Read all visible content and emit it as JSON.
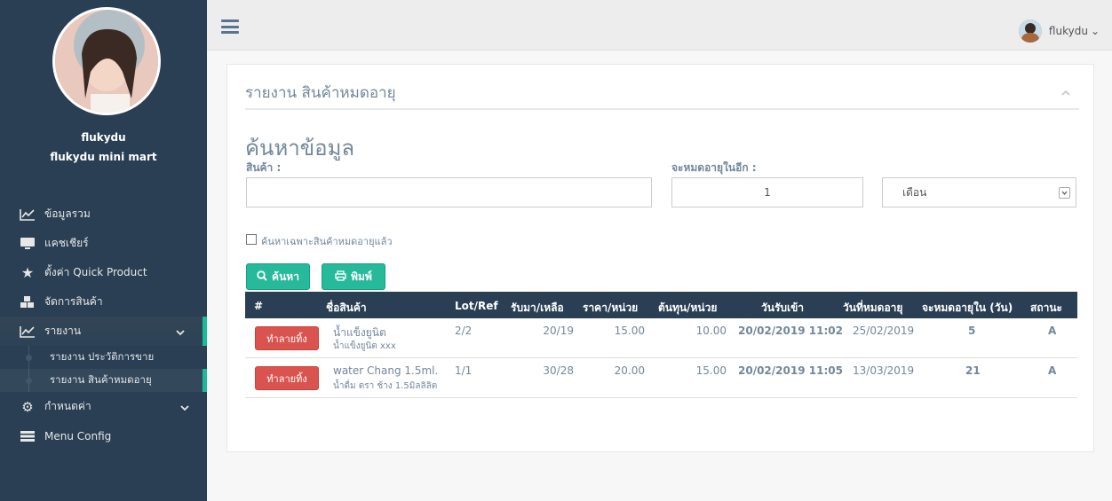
{
  "sidebar": {
    "profile_name": "flukydu",
    "store_name": "flukydu mini mart",
    "items": [
      {
        "label": "ข้อมูลรวม",
        "icon": "line-chart-icon"
      },
      {
        "label": "แคชเชียร์",
        "icon": "desktop-icon"
      },
      {
        "label": "ตั้งค่า Quick Product",
        "icon": "star-icon"
      },
      {
        "label": "จัดการสินค้า",
        "icon": "cubes-icon"
      },
      {
        "label": "รายงาน",
        "icon": "line-chart-icon"
      },
      {
        "label": "กำหนดค่า",
        "icon": "cogs-icon"
      },
      {
        "label": "Menu Config",
        "icon": "list-icon"
      }
    ],
    "sub_items": [
      {
        "label": "รายงาน ประวัติการขาย"
      },
      {
        "label": "รายงาน สินค้าหมดอายุ"
      }
    ]
  },
  "topbar": {
    "username": "flukydu",
    "caret": "⌄"
  },
  "panel": {
    "title": "รายงาน สินค้าหมดอายุ",
    "search_heading": "ค้นหาข้อมูล",
    "product_label": "สินค้า :",
    "product_value": "",
    "expire_label": "จะหมดอายุในอีก :",
    "expire_value": "1",
    "unit_selected": "เดือน",
    "checkbox_label": "ค้นหาเฉพาะสินค้าหมดอายุแล้ว",
    "search_button": "ค้นหา",
    "print_button": "พิมพ์"
  },
  "table": {
    "headers": [
      "#",
      "ชื่อสินค้า",
      "Lot/Ref",
      "รับมา/เหลือ",
      "ราคา/หน่วย",
      "ต้นทุน/หน่วย",
      "วันรับเข้า",
      "วันที่หมดอายุ",
      "จะหมดอายุใน (วัน)",
      "สถานะ"
    ],
    "rows": [
      {
        "action": "ทำลายทิ้ง",
        "name": "น้ำแข็งยูนิต",
        "sub_name": "น้ำแข็งยูนิต xxx",
        "lot": "2/2",
        "received_remaining": "20/19",
        "price": "15.00",
        "cost": "10.00",
        "received_date": "20/02/2019 11:02",
        "expire_date": "25/02/2019",
        "days_left": "5",
        "status": "A"
      },
      {
        "action": "ทำลายทิ้ง",
        "name": "water Chang 1.5ml.",
        "sub_name": "น้ำดื่ม ตรา ช้าง 1.5มิลลิลิต",
        "lot": "1/1",
        "received_remaining": "30/28",
        "price": "20.00",
        "cost": "15.00",
        "received_date": "20/02/2019 11:05",
        "expire_date": "13/03/2019",
        "days_left": "21",
        "status": "A"
      }
    ]
  },
  "colors": {
    "sidebar_bg": "#2a3f54",
    "accent_green": "#26b99a",
    "danger_red": "#d9534f",
    "table_header_bg": "#2a3f54"
  }
}
